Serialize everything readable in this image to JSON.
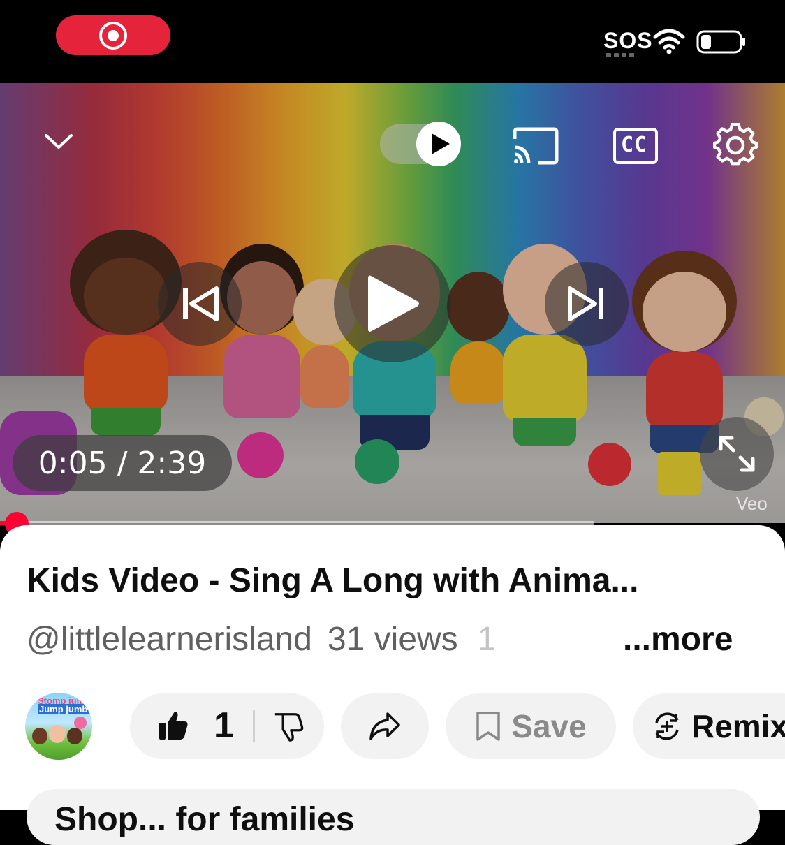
{
  "player": {
    "time_display": "0:05 / 2:39",
    "progress_fraction": 0.021,
    "buffered_fraction": 0.756,
    "watermark": "Veo",
    "controls": {
      "collapse": "chevron-down-icon",
      "autoplay_toggle": "autoplay-toggle-icon",
      "cast": "cast-icon",
      "captions": "CC",
      "settings": "gear-icon",
      "previous": "skip-previous-icon",
      "play": "play-icon",
      "next": "skip-next-icon",
      "fullscreen": "fullscreen-icon"
    }
  },
  "status_bar": {
    "sos": "SOS",
    "recording_color": "#e5243b"
  },
  "video_info": {
    "title": "Kids Video - Sing A Long with Anima...",
    "channel_handle": "@littlelearnerisland",
    "views": "31 views",
    "date_fragment": "1",
    "more_label": "...more"
  },
  "channel": {
    "avatar_text_line1": "Stomp jum",
    "avatar_text_line2": "Jump jumb!"
  },
  "actions": {
    "like_count": "1",
    "save_label": "Save",
    "remix_label": "Remix"
  },
  "next_card": {
    "text": "Shop... for families"
  },
  "colors": {
    "accent_red": "#ff0033",
    "text_primary": "#0f0f0f",
    "text_secondary": "#606060",
    "pill_bg": "#f2f2f2"
  }
}
